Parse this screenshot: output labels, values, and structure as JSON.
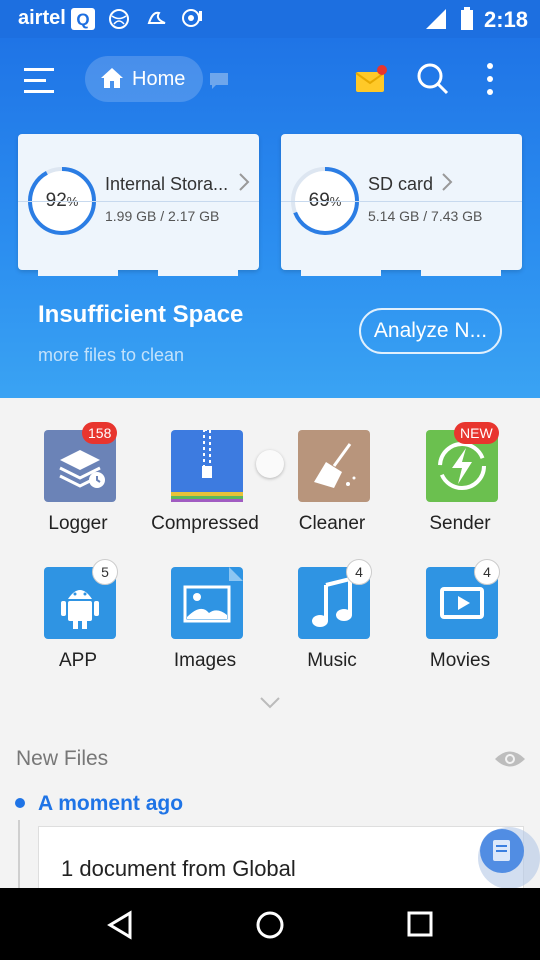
{
  "status_bar": {
    "carrier": "airtel",
    "time": "2:18"
  },
  "header": {
    "home_label": "Home",
    "storage": [
      {
        "percent": "92",
        "name": "Internal Stora...",
        "size": "1.99 GB / 2.17 GB",
        "fill": 0.92
      },
      {
        "percent": "69",
        "name": "SD card",
        "size": "5.14 GB / 7.43 GB",
        "fill": 0.69
      }
    ],
    "percent_sign": "%",
    "warning_title": "Insufficient Space",
    "warning_subtitle": "more files to clean",
    "analyze_label": "Analyze N..."
  },
  "grid": {
    "items": [
      {
        "label": "Logger",
        "badge": "158",
        "color": "#6b83b7"
      },
      {
        "label": "Compressed",
        "badge": "",
        "color": "#3d7be0"
      },
      {
        "label": "Cleaner",
        "badge": "",
        "color": "#b8957c"
      },
      {
        "label": "Sender",
        "badge": "NEW",
        "color": "#6bc04f"
      },
      {
        "label": "APP",
        "badge": "5",
        "color": "#2f94e3"
      },
      {
        "label": "Images",
        "badge": "",
        "color": "#2f94e3"
      },
      {
        "label": "Music",
        "badge": "4",
        "color": "#2f94e3"
      },
      {
        "label": "Movies",
        "badge": "4",
        "color": "#2f94e3"
      }
    ]
  },
  "new_files": {
    "title": "New Files",
    "group_label": "A moment ago",
    "item_text": "1 document from Global"
  },
  "colors": {
    "accent": "#1f74e6",
    "badge_red": "#e8352e"
  }
}
